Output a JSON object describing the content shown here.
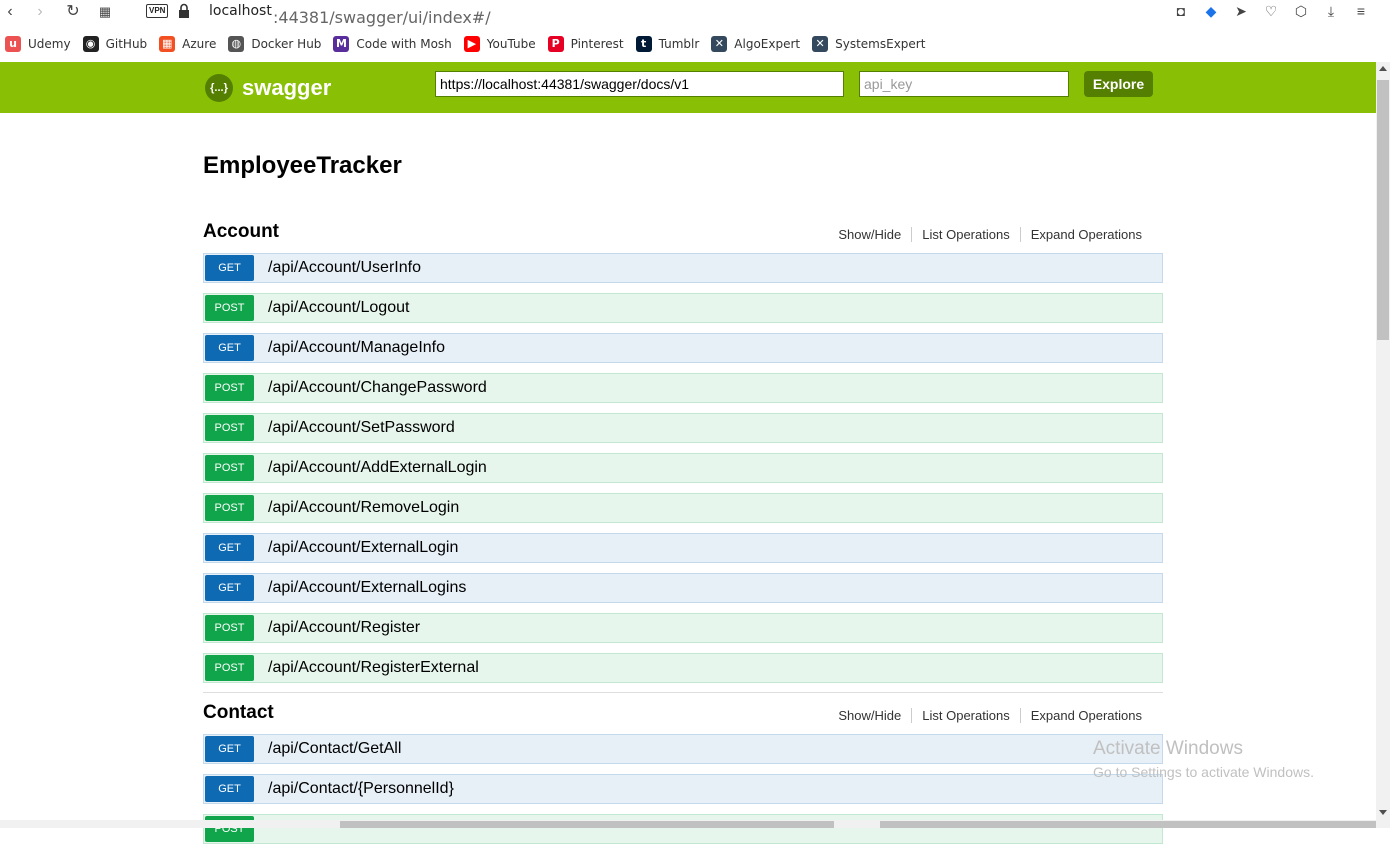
{
  "browser": {
    "url_host": "localhost",
    "url_rest": ":44381/swagger/ui/index#/",
    "vpn_label": "VPN"
  },
  "bookmarks": [
    {
      "label": "Udemy",
      "icon": "udemy-icon",
      "color": "#ec5252",
      "glyph": "u"
    },
    {
      "label": "GitHub",
      "icon": "github-icon",
      "color": "#222222",
      "glyph": "◉"
    },
    {
      "label": "Azure",
      "icon": "azure-icon",
      "color": "#f25022",
      "glyph": "▦"
    },
    {
      "label": "Docker Hub",
      "icon": "docker-icon",
      "color": "#555555",
      "glyph": "◍"
    },
    {
      "label": "Code with Mosh",
      "icon": "mosh-icon",
      "color": "#5a2d9c",
      "glyph": "M"
    },
    {
      "label": "YouTube",
      "icon": "youtube-icon",
      "color": "#ff0000",
      "glyph": "▶"
    },
    {
      "label": "Pinterest",
      "icon": "pinterest-icon",
      "color": "#e60023",
      "glyph": "P"
    },
    {
      "label": "Tumblr",
      "icon": "tumblr-icon",
      "color": "#001935",
      "glyph": "t"
    },
    {
      "label": "AlgoExpert",
      "icon": "algoexpert-icon",
      "color": "#34495e",
      "glyph": "✕"
    },
    {
      "label": "SystemsExpert",
      "icon": "systemsexpert-icon",
      "color": "#34495e",
      "glyph": "✕"
    }
  ],
  "swagger": {
    "logo_glyph": "{...}",
    "brand": "swagger",
    "url_value": "https://localhost:44381/swagger/docs/v1",
    "api_key_placeholder": "api_key",
    "explore_label": "Explore",
    "colors": {
      "header": "#89bf04",
      "dark": "#547f00",
      "get": "#0f6ab4",
      "post": "#10a54a"
    }
  },
  "app_title": "EmployeeTracker",
  "section_links": [
    "Show/Hide",
    "List Operations",
    "Expand Operations"
  ],
  "sections": [
    {
      "name": "Account",
      "operations": [
        {
          "method": "GET",
          "path": "/api/Account/UserInfo"
        },
        {
          "method": "POST",
          "path": "/api/Account/Logout"
        },
        {
          "method": "GET",
          "path": "/api/Account/ManageInfo"
        },
        {
          "method": "POST",
          "path": "/api/Account/ChangePassword"
        },
        {
          "method": "POST",
          "path": "/api/Account/SetPassword"
        },
        {
          "method": "POST",
          "path": "/api/Account/AddExternalLogin"
        },
        {
          "method": "POST",
          "path": "/api/Account/RemoveLogin"
        },
        {
          "method": "GET",
          "path": "/api/Account/ExternalLogin"
        },
        {
          "method": "GET",
          "path": "/api/Account/ExternalLogins"
        },
        {
          "method": "POST",
          "path": "/api/Account/Register"
        },
        {
          "method": "POST",
          "path": "/api/Account/RegisterExternal"
        }
      ]
    },
    {
      "name": "Contact",
      "operations": [
        {
          "method": "GET",
          "path": "/api/Contact/GetAll"
        },
        {
          "method": "GET",
          "path": "/api/Contact/{PersonnelId}"
        },
        {
          "method": "POST",
          "path": ""
        }
      ]
    }
  ],
  "watermark": {
    "line1": "Activate Windows",
    "line2": "Go to Settings to activate Windows."
  }
}
